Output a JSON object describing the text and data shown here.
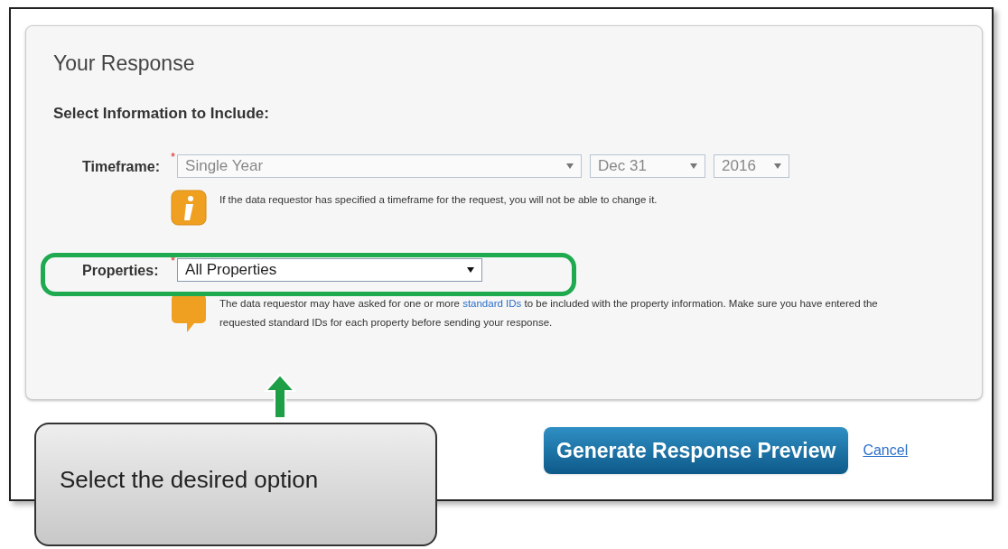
{
  "panel": {
    "title": "Your Response",
    "section": "Select Information to Include:"
  },
  "fields": [
    {
      "label": "Timeframe:",
      "required_mark": "*",
      "selects": [
        {
          "value": "Single Year",
          "disabled": true
        },
        {
          "value": "Dec 31",
          "disabled": true
        },
        {
          "value": "2016",
          "disabled": true
        }
      ],
      "note": {
        "before": "If the data requestor has specified a timeframe for the request, you will not be able to change it."
      }
    },
    {
      "label": "Properties:",
      "required_mark": "*",
      "selects": [
        {
          "value": "All Properties",
          "disabled": false
        }
      ],
      "note": {
        "before": "The data requestor may have asked for one or more ",
        "link": "standard IDs",
        "after": " to be included with the property information. Make sure you have entered the requested standard IDs for each property before sending your response."
      }
    }
  ],
  "actions": {
    "primary": "Generate Response Preview",
    "cancel": "Cancel"
  },
  "callout": {
    "text": "Select the desired option"
  }
}
